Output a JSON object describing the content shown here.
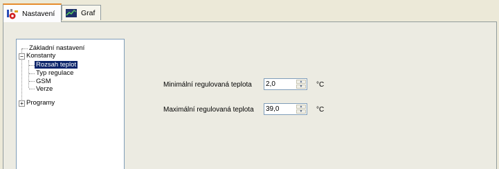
{
  "tabs": [
    {
      "label": "Nastavení",
      "icon": "settings-icon"
    },
    {
      "label": "Graf",
      "icon": "chart-icon"
    }
  ],
  "tree": {
    "items": [
      {
        "label": "Základní nastavení"
      },
      {
        "label": "Konstanty",
        "expander": "−"
      },
      {
        "label": "Rozsah teplot",
        "selected": true
      },
      {
        "label": "Typ regulace"
      },
      {
        "label": "GSM"
      },
      {
        "label": "Verze"
      },
      {
        "label": "Programy",
        "expander": "+"
      }
    ]
  },
  "form": {
    "min_label": "Minimální regulovaná teplota",
    "min_value": "2,0",
    "max_label": "Maximální regulovaná teplota",
    "max_value": "39,0",
    "unit": "°C"
  }
}
